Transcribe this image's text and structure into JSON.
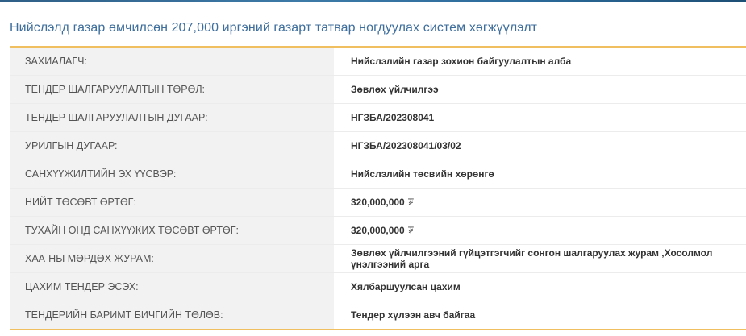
{
  "title": "Нийслэлд газар өмчилсөн 207,000 иргэний газарт татвар ногдуулах систем хөгжүүлэлт",
  "rows": [
    {
      "label": "ЗАХИАЛАГЧ:",
      "value": "Нийслэлийн газар зохион байгуулалтын алба"
    },
    {
      "label": "ТЕНДЕР ШАЛГАРУУЛАЛТЫН ТӨРӨЛ:",
      "value": "Зөвлөх үйлчилгээ"
    },
    {
      "label": "ТЕНДЕР ШАЛГАРУУЛАЛТЫН ДУГААР:",
      "value": "НГЗБА/202308041"
    },
    {
      "label": "УРИЛГЫН ДУГААР:",
      "value": "НГЗБА/202308041/03/02"
    },
    {
      "label": "САНХҮҮЖИЛТИЙН ЭХ ҮҮСВЭР:",
      "value": "Нийслэлийн төсвийн хөрөнгө"
    },
    {
      "label": "НИЙТ ТӨСӨВТ ӨРТӨГ:",
      "value": "320,000,000",
      "currency": "₮"
    },
    {
      "label": "ТУХАЙН ОНД САНХҮҮЖИХ ТӨСӨВТ ӨРТӨГ:",
      "value": "320,000,000",
      "currency": "₮"
    },
    {
      "label": "ХАА-НЫ МӨРДӨХ ЖУРАМ:",
      "value": "Зөвлөх үйлчилгээний гүйцэтгэгчийг сонгон шалгаруулах журам ,Хосолмол үнэлгээний арга"
    },
    {
      "label": "ЦАХИМ ТЕНДЕР ЭСЭХ:",
      "value": "Хялбаршуулсан цахим"
    },
    {
      "label": "ТЕНДЕРИЙН БАРИМТ БИЧГИЙН ТӨЛӨВ:",
      "value": "Тендер хүлээн авч байгаа"
    }
  ]
}
